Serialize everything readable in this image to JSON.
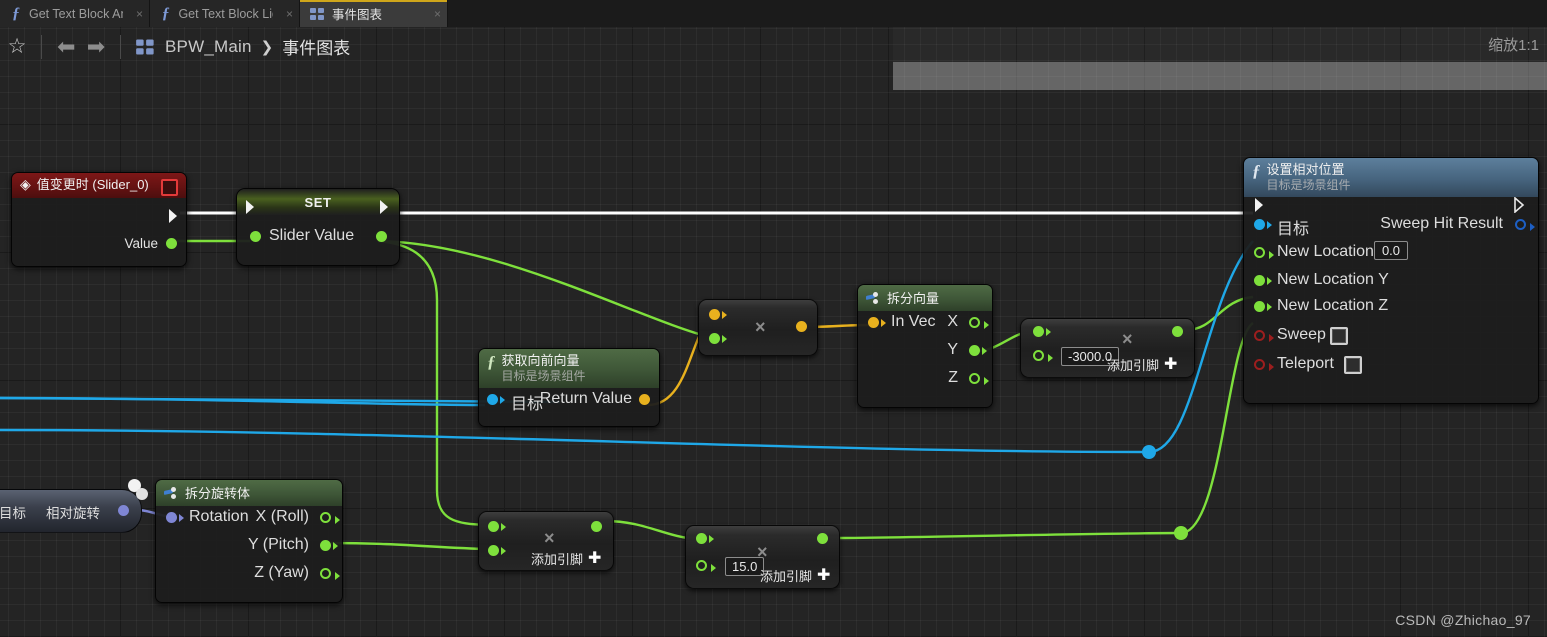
{
  "window": {
    "zoom_label": "缩放1:1",
    "watermark": "CSDN @Zhichao_97"
  },
  "tabs": [
    {
      "label": "Get Text Block Ant",
      "icon": "function-icon",
      "close": "×",
      "active": false
    },
    {
      "label": "Get Text Block Ligh",
      "icon": "function-icon",
      "close": "×",
      "active": false
    },
    {
      "label": "事件图表",
      "icon": "graph-icon",
      "close": "×",
      "active": true
    }
  ],
  "toolbar": {
    "favorite_icon": "star-icon",
    "back_icon": "arrow-left-icon",
    "forward_icon": "arrow-right-icon",
    "breadcrumb_icon": "graph-icon",
    "breadcrumb_root": "BPW_Main",
    "breadcrumb_sep": "❯",
    "breadcrumb_leaf": "事件图表"
  },
  "nodes": {
    "event_value_changed": {
      "title": "值变更时 (Slider_0)",
      "icon": "event-diamond-icon",
      "delegate_icon": "red-square-icon",
      "out_exec": "",
      "out_value": "Value"
    },
    "set_slider_value": {
      "title": "SET",
      "pin": "Slider Value"
    },
    "get_forward_vector": {
      "title": "获取向前向量",
      "subtitle": "目标是场景组件",
      "icon": "function-icon",
      "in_target": "目标",
      "out_return": "Return Value"
    },
    "multiply_forward": {
      "symbol": "×"
    },
    "break_vector": {
      "title": "拆分向量",
      "icon": "break-icon",
      "in_vec": "In Vec",
      "out_x": "X",
      "out_y": "Y",
      "out_z": "Z"
    },
    "multiply_3000": {
      "symbol": "×",
      "value": "-3000.0",
      "add_pin": "添加引脚",
      "plus": "✚"
    },
    "set_relative_location": {
      "title": "设置相对位置",
      "subtitle": "目标是场景组件",
      "icon": "function-icon",
      "in_target": "目标",
      "out_sweep_hit": "Sweep Hit Result",
      "in_loc_x": "New Location X",
      "in_loc_x_value": "0.0",
      "in_loc_y": "New Location Y",
      "in_loc_z": "New Location Z",
      "in_sweep": "Sweep",
      "in_teleport": "Teleport"
    },
    "break_rotator": {
      "title": "拆分旋转体",
      "icon": "break-icon",
      "in_rotation": "Rotation",
      "out_roll": "X (Roll)",
      "out_pitch": "Y (Pitch)",
      "out_yaw": "Z (Yaw)"
    },
    "partial_left_node": {
      "in_target": "目标",
      "out_rel_rotation": "相对旋转"
    },
    "multiply_mid": {
      "symbol": "×",
      "add_pin": "添加引脚",
      "plus": "✚"
    },
    "multiply_15": {
      "symbol": "×",
      "value": "15.0",
      "add_pin": "添加引脚",
      "plus": "✚"
    }
  },
  "colors": {
    "exec_wire": "#ffffff",
    "float_wire": "#7ee03c",
    "vector_wire": "#e8b11e",
    "object_wire": "#1fa8e8",
    "rotator_wire": "#7f86d4",
    "accent_tab": "#cfa61b",
    "canvas_bg": "#242424"
  }
}
